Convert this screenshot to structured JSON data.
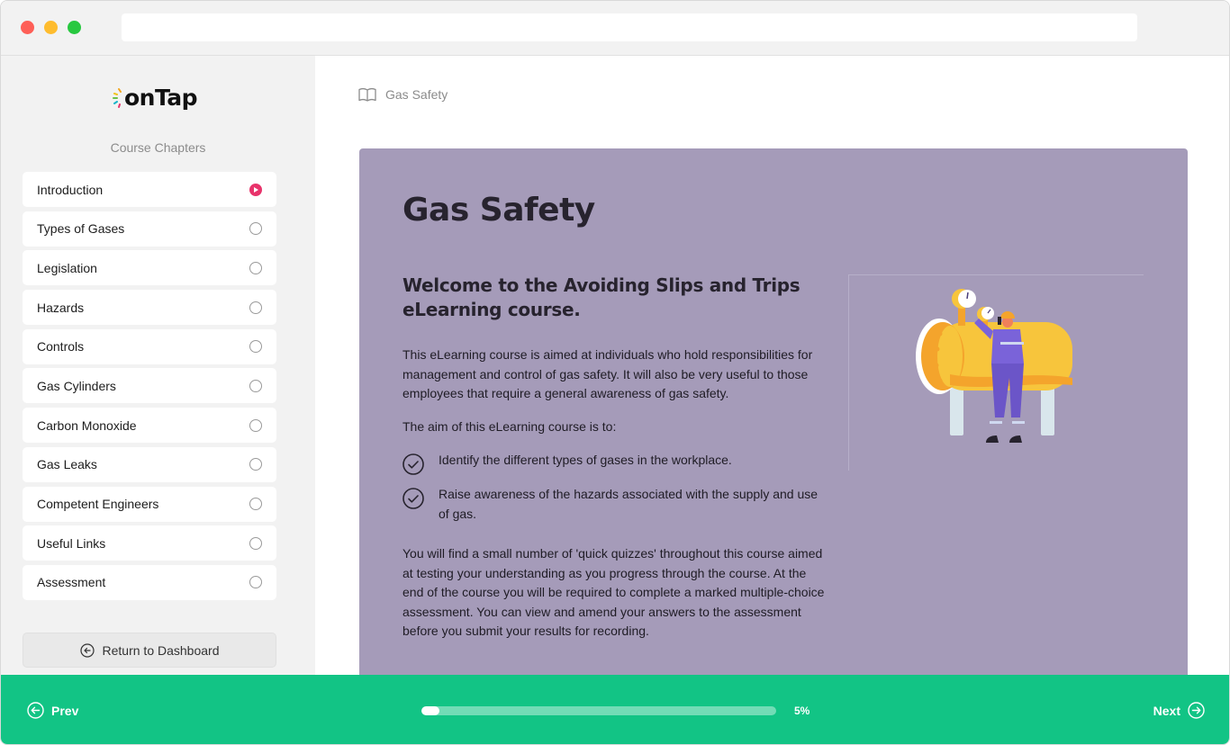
{
  "app": {
    "logo_text": "onTap"
  },
  "sidebar": {
    "title": "Course Chapters",
    "chapters": [
      {
        "label": "Introduction",
        "status": "active"
      },
      {
        "label": "Types of Gases",
        "status": "incomplete"
      },
      {
        "label": "Legislation",
        "status": "incomplete"
      },
      {
        "label": "Hazards",
        "status": "incomplete"
      },
      {
        "label": "Controls",
        "status": "incomplete"
      },
      {
        "label": "Gas Cylinders",
        "status": "incomplete"
      },
      {
        "label": "Carbon Monoxide",
        "status": "incomplete"
      },
      {
        "label": "Gas Leaks",
        "status": "incomplete"
      },
      {
        "label": "Competent Engineers",
        "status": "incomplete"
      },
      {
        "label": "Useful Links",
        "status": "incomplete"
      },
      {
        "label": "Assessment",
        "status": "incomplete"
      }
    ],
    "return_label": "Return to Dashboard"
  },
  "breadcrumb": {
    "label": "Gas Safety",
    "icon": "book-icon"
  },
  "content": {
    "title": "Gas Safety",
    "subtitle": "Welcome to the Avoiding Slips and Trips eLearning course.",
    "intro": "This eLearning course is aimed at individuals who hold responsibilities for management and control of gas safety. It will also be very useful to those employees that require a general awareness of gas safety.",
    "aim_intro": "The aim of this eLearning course is to:",
    "aims": [
      "Identify the different types of gases in the workplace.",
      "Raise awareness of the hazards associated with the supply and use of gas."
    ],
    "quiz_info": "You will find a small number of 'quick quizzes' throughout this course aimed at testing your understanding as you progress through the course.  At the end of the course you will be required to complete a marked multiple-choice assessment. You can view and amend your answers to the assessment before you submit your results for recording."
  },
  "footer": {
    "prev_label": "Prev",
    "next_label": "Next",
    "progress_value": 0.05,
    "progress_text": "5%"
  },
  "colors": {
    "accent_green": "#12c485",
    "card_purple": "#a59bb9",
    "active_pink": "#e8336b"
  }
}
